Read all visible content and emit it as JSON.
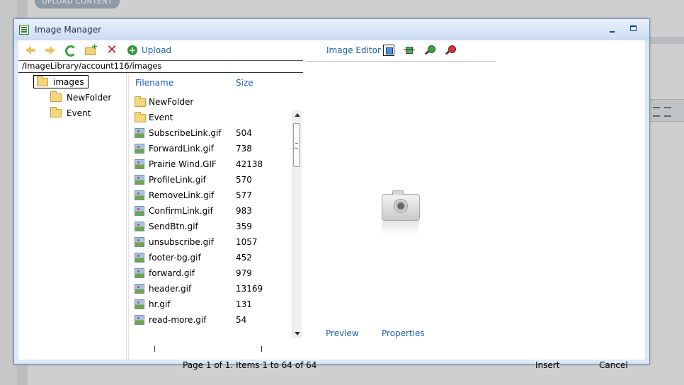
{
  "background": {
    "top_button": "UPLOAD CONTENT"
  },
  "window": {
    "title": "Image Manager"
  },
  "toolbar": {
    "upload_label": "Upload",
    "image_editor_label": "Image Editor"
  },
  "path": "/ImageLibrary/account116/images",
  "tree": {
    "root": "images",
    "children": [
      "NewFolder",
      "Event"
    ]
  },
  "columns": {
    "filename": "Filename",
    "size": "Size"
  },
  "files": [
    {
      "name": "NewFolder",
      "size": "",
      "type": "folder"
    },
    {
      "name": "Event",
      "size": "",
      "type": "folder"
    },
    {
      "name": "SubscribeLink.gif",
      "size": "504",
      "type": "image"
    },
    {
      "name": "ForwardLink.gif",
      "size": "738",
      "type": "image"
    },
    {
      "name": "Prairie Wind.GIF",
      "size": "42138",
      "type": "image"
    },
    {
      "name": "ProfileLink.gif",
      "size": "570",
      "type": "image"
    },
    {
      "name": "RemoveLink.gif",
      "size": "577",
      "type": "image"
    },
    {
      "name": "ConfirmLink.gif",
      "size": "983",
      "type": "image"
    },
    {
      "name": "SendBtn.gif",
      "size": "359",
      "type": "image"
    },
    {
      "name": "unsubscribe.gif",
      "size": "1057",
      "type": "image"
    },
    {
      "name": "footer-bg.gif",
      "size": "452",
      "type": "image"
    },
    {
      "name": "forward.gif",
      "size": "979",
      "type": "image"
    },
    {
      "name": "header.gif",
      "size": "13169",
      "type": "image"
    },
    {
      "name": "hr.gif",
      "size": "131",
      "type": "image"
    },
    {
      "name": "read-more.gif",
      "size": "54",
      "type": "image"
    }
  ],
  "pager": "Page 1 of 1. Items 1 to 64 of 64",
  "preview": {
    "preview_tab": "Preview",
    "properties_tab": "Properties"
  },
  "actions": {
    "insert": "Insert",
    "cancel": "Cancel"
  }
}
